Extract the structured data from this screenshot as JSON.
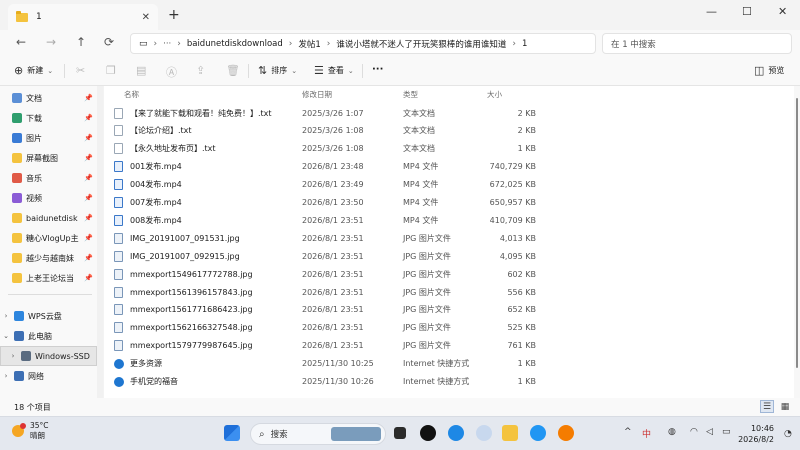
{
  "tab": {
    "title": "1",
    "close": "✕",
    "new": "+"
  },
  "window": {
    "minimize": "—",
    "maximize": "☐",
    "close": "✕"
  },
  "address": {
    "segments": [
      "baidunetdiskdownload",
      "发帖1",
      "谁说小塔就不迷人了开玩笑狠棒的谁用谁知道",
      "1"
    ],
    "search_placeholder": "在 1 中搜索"
  },
  "toolbar": {
    "new_label": "新建",
    "sort_label": "排序",
    "view_label": "查看",
    "more_label": "···",
    "preview_label": "预览"
  },
  "sidebar": {
    "items": [
      {
        "label": "文档",
        "color": "#5b8fd6",
        "pinned": true
      },
      {
        "label": "下载",
        "color": "#2f9e6e",
        "pinned": true
      },
      {
        "label": "图片",
        "color": "#3a7bd5",
        "pinned": true
      },
      {
        "label": "屏幕截图",
        "color": "#f4c33f",
        "pinned": true
      },
      {
        "label": "音乐",
        "color": "#e05a47",
        "pinned": true
      },
      {
        "label": "视频",
        "color": "#8b5cd6",
        "pinned": true
      },
      {
        "label": "baidunetdisk",
        "color": "#f4c33f",
        "pinned": true
      },
      {
        "label": "糖心VlogUp主",
        "color": "#f4c33f",
        "pinned": true
      },
      {
        "label": "越少与越南妹",
        "color": "#f4c33f",
        "pinned": true
      },
      {
        "label": "上老王论坛当",
        "color": "#f4c33f",
        "pinned": true
      }
    ],
    "tree": [
      {
        "label": "WPS云盘",
        "chev": "›",
        "color": "#2e86de"
      },
      {
        "label": "此电脑",
        "chev": "⌄",
        "color": "#3d6fb4"
      },
      {
        "label": "Windows-SSD",
        "chev": "›",
        "color": "#5a6b80",
        "selected": true
      },
      {
        "label": "网络",
        "chev": "›",
        "color": "#3d6fb4"
      }
    ]
  },
  "columns": {
    "name": "名称",
    "date": "修改日期",
    "type": "类型",
    "size": "大小"
  },
  "files": [
    {
      "name": "【来了就能下载和观看！纯免费！】.txt",
      "date": "2025/3/26 1:07",
      "type": "文本文档",
      "size": "2 KB",
      "kind": "txt"
    },
    {
      "name": "【论坛介绍】.txt",
      "date": "2025/3/26 1:08",
      "type": "文本文档",
      "size": "2 KB",
      "kind": "txt"
    },
    {
      "name": "【永久地址发布页】.txt",
      "date": "2025/3/26 1:08",
      "type": "文本文档",
      "size": "1 KB",
      "kind": "txt"
    },
    {
      "name": "001发布.mp4",
      "date": "2026/8/1 23:48",
      "type": "MP4 文件",
      "size": "740,729 KB",
      "kind": "vid"
    },
    {
      "name": "004发布.mp4",
      "date": "2026/8/1 23:49",
      "type": "MP4 文件",
      "size": "672,025 KB",
      "kind": "vid"
    },
    {
      "name": "007发布.mp4",
      "date": "2026/8/1 23:50",
      "type": "MP4 文件",
      "size": "650,957 KB",
      "kind": "vid"
    },
    {
      "name": "008发布.mp4",
      "date": "2026/8/1 23:51",
      "type": "MP4 文件",
      "size": "410,709 KB",
      "kind": "vid"
    },
    {
      "name": "IMG_20191007_091531.jpg",
      "date": "2026/8/1 23:51",
      "type": "JPG 图片文件",
      "size": "4,013 KB",
      "kind": "jpg"
    },
    {
      "name": "IMG_20191007_092915.jpg",
      "date": "2026/8/1 23:51",
      "type": "JPG 图片文件",
      "size": "4,095 KB",
      "kind": "jpg"
    },
    {
      "name": "mmexport1549617772788.jpg",
      "date": "2026/8/1 23:51",
      "type": "JPG 图片文件",
      "size": "602 KB",
      "kind": "jpg"
    },
    {
      "name": "mmexport1561396157843.jpg",
      "date": "2026/8/1 23:51",
      "type": "JPG 图片文件",
      "size": "556 KB",
      "kind": "jpg"
    },
    {
      "name": "mmexport1561771686423.jpg",
      "date": "2026/8/1 23:51",
      "type": "JPG 图片文件",
      "size": "652 KB",
      "kind": "jpg"
    },
    {
      "name": "mmexport1562166327548.jpg",
      "date": "2026/8/1 23:51",
      "type": "JPG 图片文件",
      "size": "525 KB",
      "kind": "jpg"
    },
    {
      "name": "mmexport1579779987645.jpg",
      "date": "2026/8/1 23:51",
      "type": "JPG 图片文件",
      "size": "761 KB",
      "kind": "jpg"
    },
    {
      "name": "更多资源",
      "date": "2025/11/30 10:25",
      "type": "Internet 快捷方式",
      "size": "1 KB",
      "kind": "url"
    },
    {
      "name": "手机党的福音",
      "date": "2025/11/30 10:26",
      "type": "Internet 快捷方式",
      "size": "1 KB",
      "kind": "url"
    }
  ],
  "status": {
    "count": "18 个项目"
  },
  "taskbar": {
    "weather_temp": "35°C",
    "weather_desc": "晴朗",
    "search_label": "搜索",
    "time": "10:46",
    "date": "2026/8/2"
  }
}
